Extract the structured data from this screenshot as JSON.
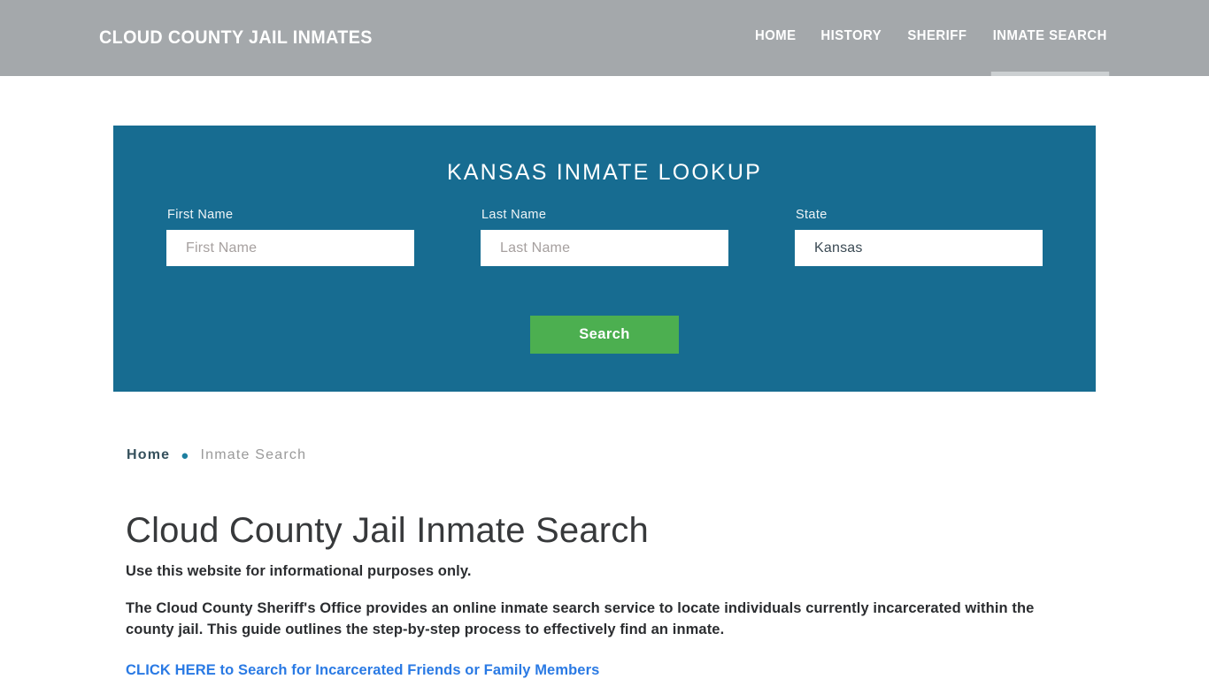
{
  "header": {
    "brand": "CLOUD COUNTY JAIL INMATES",
    "background_color": "#a4a8ab",
    "nav": [
      {
        "label": "HOME",
        "active": false
      },
      {
        "label": "HISTORY",
        "active": false
      },
      {
        "label": "SHERIFF",
        "active": false
      },
      {
        "label": "INMATE SEARCH",
        "active": true
      }
    ]
  },
  "lookup_panel": {
    "title": "KANSAS INMATE LOOKUP",
    "panel_color": "#176c91",
    "fields": {
      "first_name": {
        "label": "First Name",
        "placeholder": "First Name",
        "value": ""
      },
      "last_name": {
        "label": "Last Name",
        "placeholder": "Last Name",
        "value": ""
      },
      "state": {
        "label": "State",
        "selected": "Kansas",
        "options": [
          "Kansas"
        ]
      }
    },
    "search_button": {
      "label": "Search",
      "color": "#4caf50"
    }
  },
  "breadcrumb": {
    "home": "Home",
    "separator": "●",
    "current": "Inmate Search"
  },
  "content": {
    "page_title": "Cloud County Jail Inmate Search",
    "lead": "Use this website for informational purposes only.",
    "paragraph": "The Cloud County Sheriff's Office provides an online inmate search service to locate individuals currently incarcerated within the county jail. This guide outlines the step-by-step process to effectively find an inmate.",
    "cta_link": {
      "label": "CLICK HERE to Search for Incarcerated Friends or Family Members",
      "color": "#2a7ae4"
    }
  }
}
